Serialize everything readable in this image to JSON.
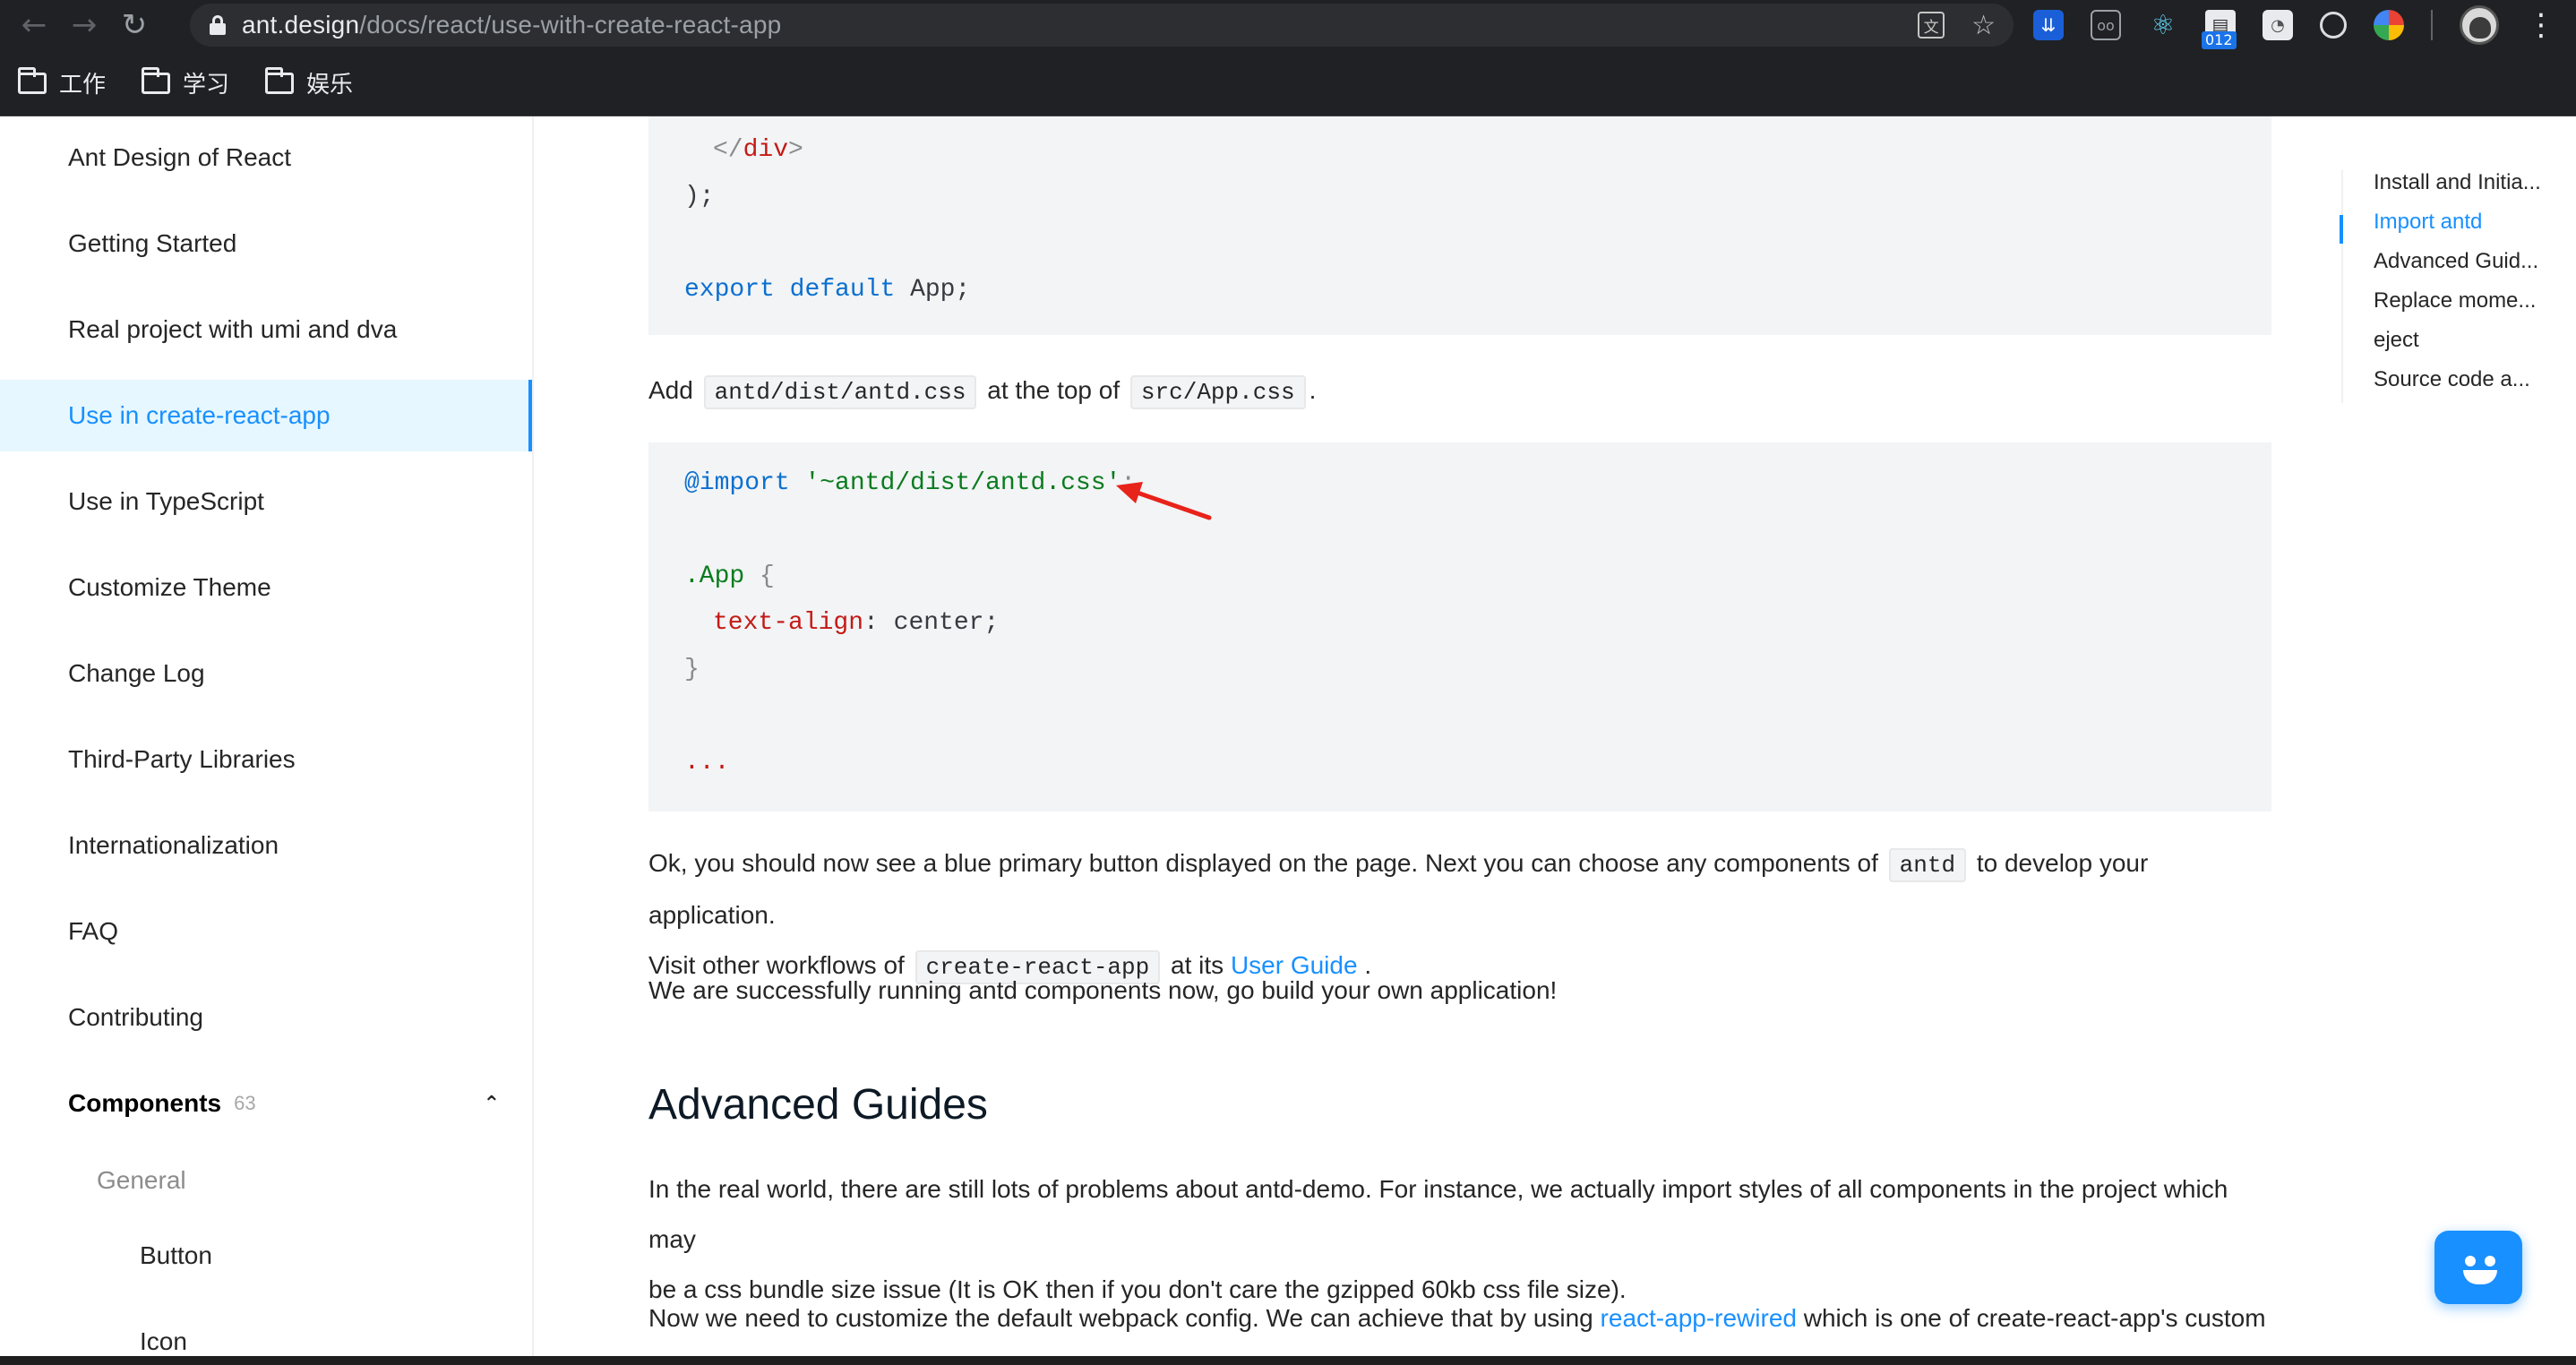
{
  "browser": {
    "url_host": "ant.design",
    "url_path": "/docs/react/use-with-create-react-app",
    "bookmarks": [
      "工作",
      "学习",
      "娱乐"
    ],
    "extension_badge": "012"
  },
  "sidebar": {
    "items": [
      {
        "label": "Ant Design of React"
      },
      {
        "label": "Getting Started"
      },
      {
        "label": "Real project with umi and dva"
      },
      {
        "label": "Use in create-react-app",
        "active": true
      },
      {
        "label": "Use in TypeScript"
      },
      {
        "label": "Customize Theme"
      },
      {
        "label": "Change Log"
      },
      {
        "label": "Third-Party Libraries"
      },
      {
        "label": "Internationalization"
      },
      {
        "label": "FAQ"
      },
      {
        "label": "Contributing"
      }
    ],
    "components_group": {
      "label": "Components",
      "count": "63"
    },
    "general_label": "General",
    "sub_items": [
      "Button",
      "Icon"
    ]
  },
  "code_top": {
    "line1_close": "</",
    "line1_tag": "div",
    "line1_end": ">",
    "line2": ");",
    "line3_kw1": "export",
    "line3_kw2": "default",
    "line3_rest": " App;"
  },
  "para_add": {
    "pre": "Add",
    "code1": "antd/dist/antd.css",
    "mid": "at the top of",
    "code2": "src/App.css",
    "post": "."
  },
  "code_css": {
    "import_kw": "@import",
    "import_str": "'~antd/dist/antd.css'",
    "import_end": ";",
    "selector": ".App",
    "brace_open": " {",
    "prop": "text-align",
    "prop_val": ": center;",
    "brace_close": "}",
    "ellipsis": "..."
  },
  "para_ok": {
    "line1_pre": "Ok, you should now see a blue primary button displayed on the page. Next you can choose any components of",
    "line1_code": "antd",
    "line1_post": "to develop your application.",
    "line2_pre": "Visit other workflows of",
    "line2_code": "create-react-app",
    "line2_mid": "at its",
    "line2_link": "User Guide",
    "line2_post": "."
  },
  "para_success": "We are successfully running antd components now, go build your own application!",
  "heading_advanced": "Advanced Guides",
  "para_realworld": {
    "line1": "In the real world, there are still lots of problems about antd-demo. For instance, we actually import styles of all components in the project which may",
    "line2": "be a css bundle size issue (It is OK then if you don't care the gzipped 60kb css file size)."
  },
  "para_webpack": {
    "pre": "Now we need to customize the default webpack config. We can achieve that by using",
    "link": "react-app-rewired",
    "post": "which is one of create-react-app's custom"
  },
  "toc": {
    "items": [
      {
        "label": "Install and Initia..."
      },
      {
        "label": "Import antd",
        "active": true
      },
      {
        "label": "Advanced Guid..."
      },
      {
        "label": "Replace mome..."
      },
      {
        "label": "eject"
      },
      {
        "label": "Source code a..."
      }
    ]
  },
  "colors": {
    "accent": "#1890ff",
    "active_bg": "#e6f7ff",
    "code_bg": "#f2f4f5",
    "annotation_arrow": "#e8231a"
  }
}
